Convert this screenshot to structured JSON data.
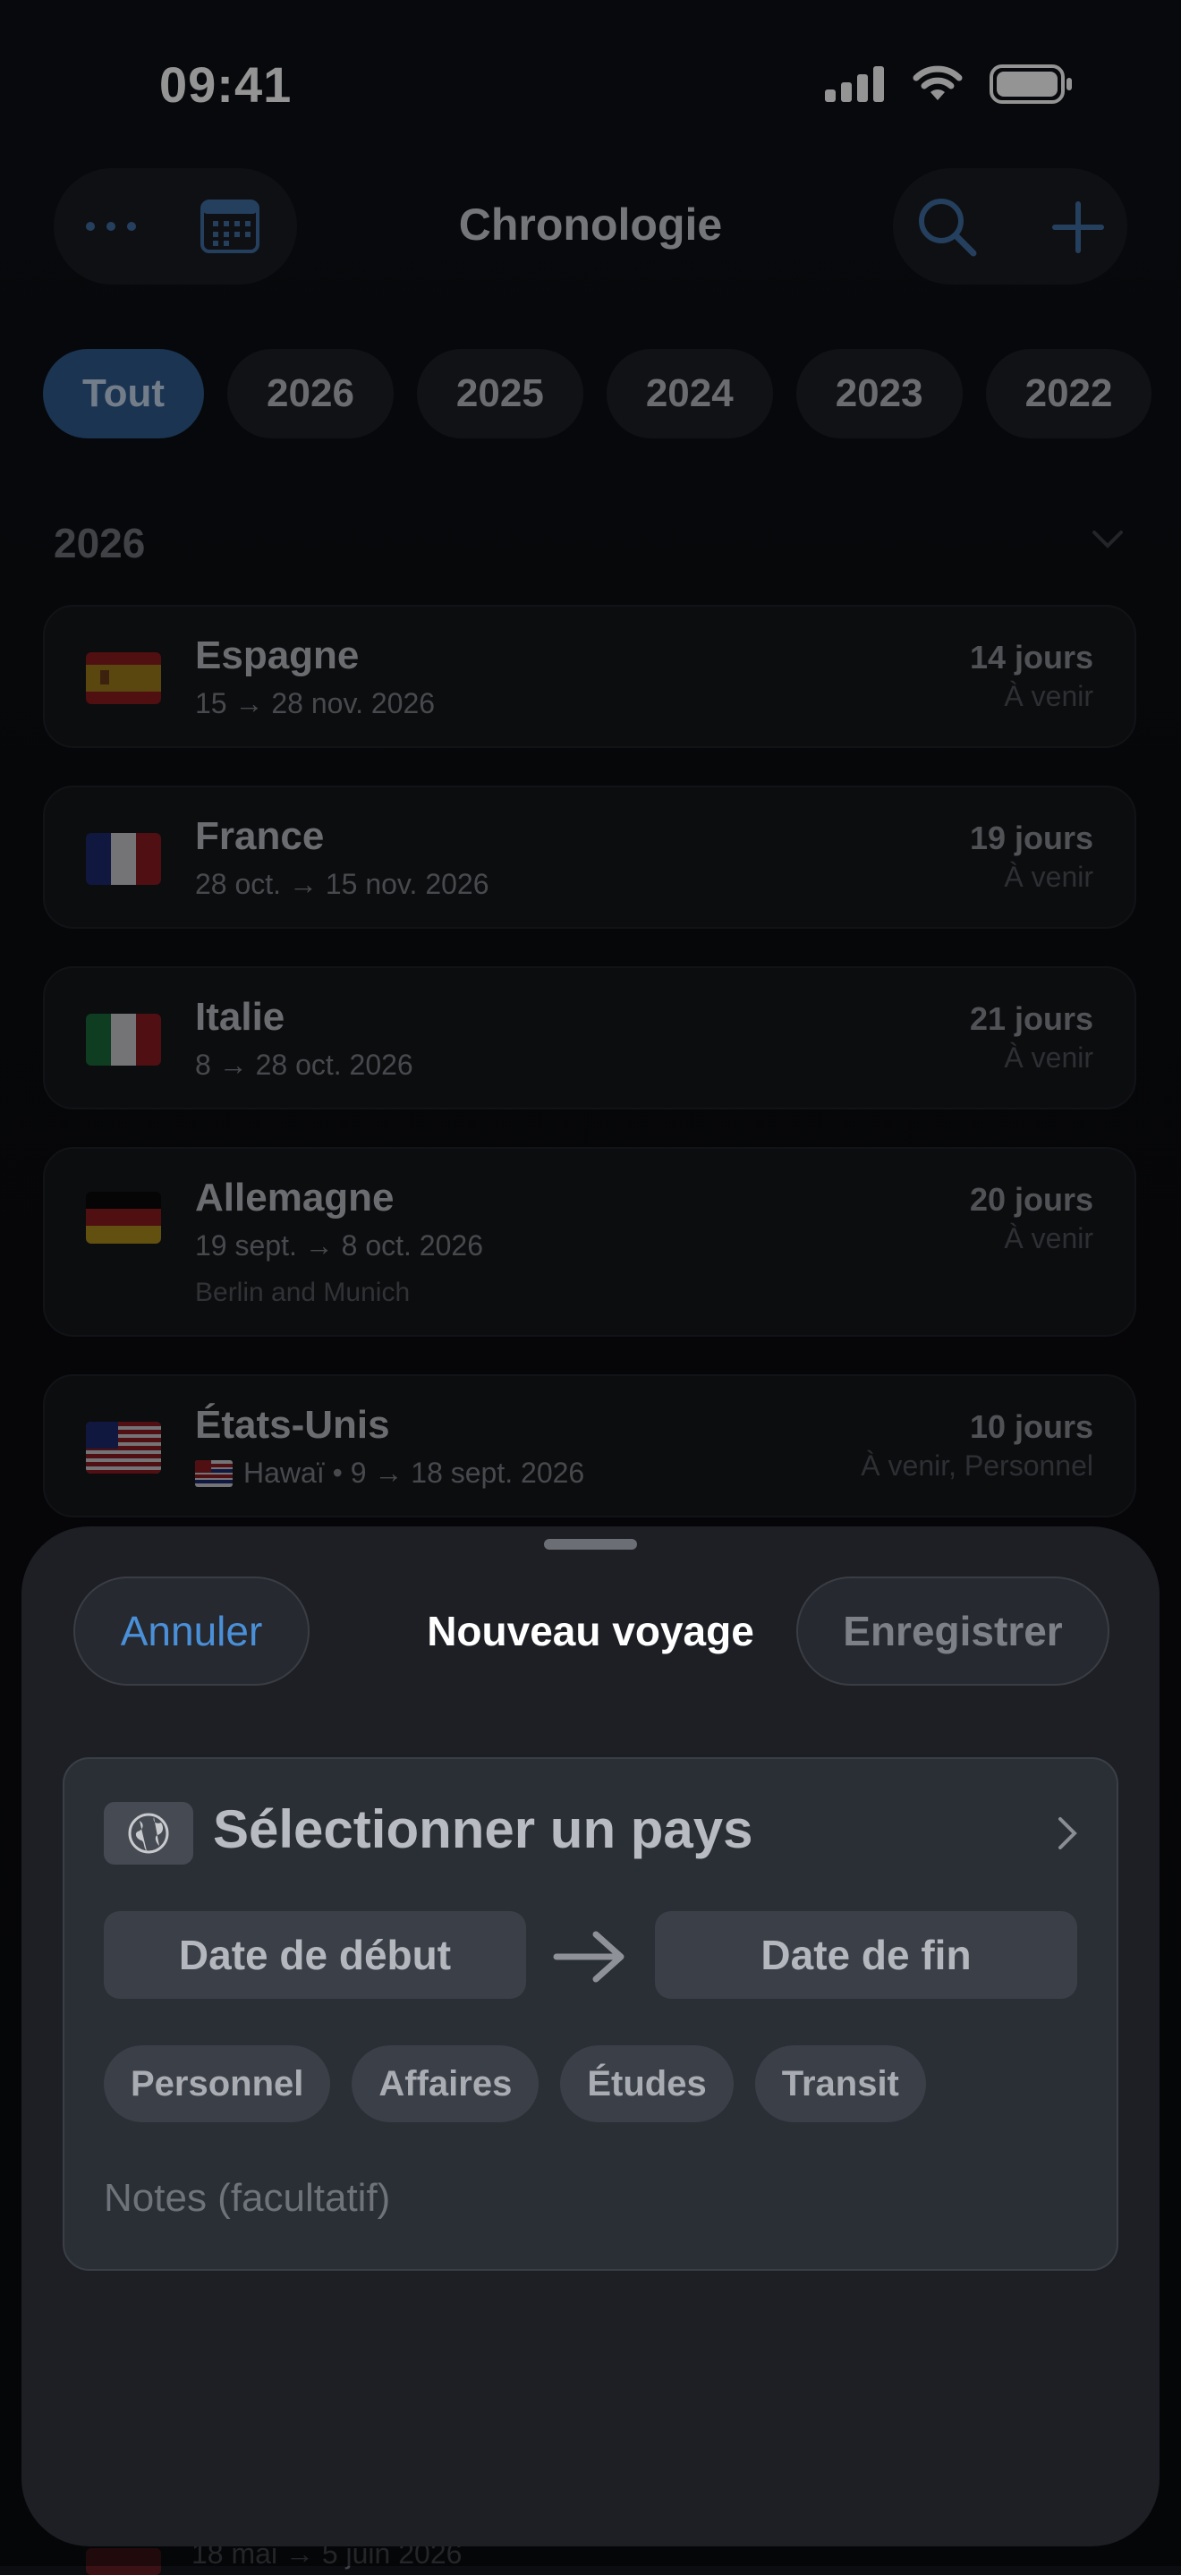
{
  "status_bar": {
    "time": "09:41"
  },
  "nav": {
    "title": "Chronologie"
  },
  "year_filters": [
    {
      "label": "Tout",
      "active": true
    },
    {
      "label": "2026",
      "active": false
    },
    {
      "label": "2025",
      "active": false
    },
    {
      "label": "2024",
      "active": false
    },
    {
      "label": "2023",
      "active": false
    },
    {
      "label": "2022",
      "active": false
    }
  ],
  "section": {
    "year": "2026"
  },
  "trips": [
    {
      "country": "Espagne",
      "dates": "15 → 28 nov. 2026",
      "days": "14 jours",
      "status": "À venir",
      "flag": "spain-flag"
    },
    {
      "country": "France",
      "dates": "28 oct. → 15 nov. 2026",
      "days": "19 jours",
      "status": "À venir",
      "flag": "france-flag"
    },
    {
      "country": "Italie",
      "dates": "8 → 28 oct. 2026",
      "days": "21 jours",
      "status": "À venir",
      "flag": "italy-flag"
    },
    {
      "country": "Allemagne",
      "dates": "19 sept. → 8 oct. 2026",
      "note": "Berlin and Munich",
      "days": "20 jours",
      "status": "À venir",
      "flag": "germany-flag"
    },
    {
      "country": "États-Unis",
      "dates": "Hawaï • 9 → 18 sept. 2026",
      "days": "10 jours",
      "status": "À venir, Personnel",
      "flag": "usa-flag",
      "sub_flag": "hawaii-flag"
    }
  ],
  "peek_trip": {
    "dates": "18 mai → 5 juin 2026"
  },
  "sheet": {
    "cancel_label": "Annuler",
    "title": "Nouveau voyage",
    "save_label": "Enregistrer",
    "country_placeholder": "Sélectionner un pays",
    "start_date": "Date de début",
    "end_date": "Date de fin",
    "tags": [
      "Personnel",
      "Affaires",
      "Études",
      "Transit"
    ],
    "notes_placeholder": "Notes (facultatif)"
  },
  "colors": {
    "accent": "#4a90d9",
    "active_chip": "#2d5a8c",
    "sheet_bg": "#1d1f24"
  }
}
